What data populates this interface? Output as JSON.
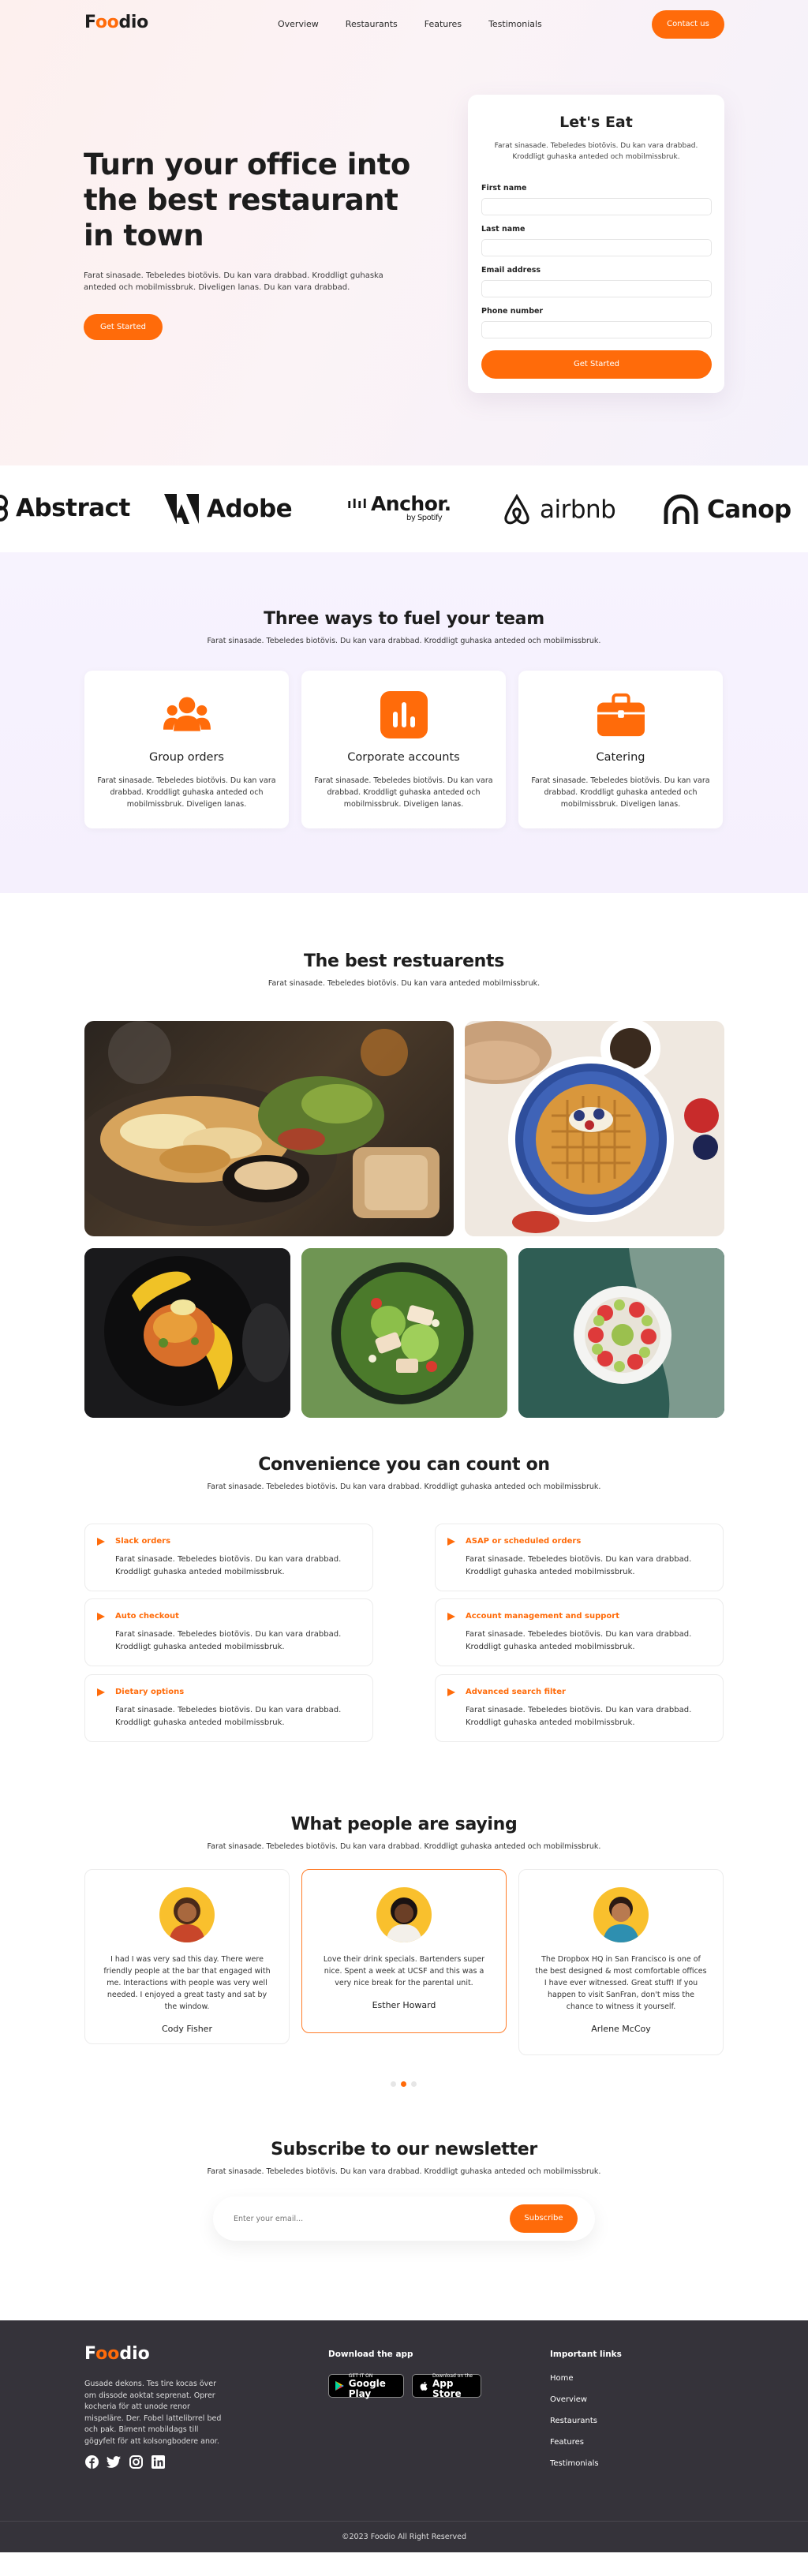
{
  "brand": {
    "name_prefix": "F",
    "name_oo": "oo",
    "name_suffix": "dio",
    "accent": "#ff6b0a"
  },
  "nav": {
    "links": [
      "Overview",
      "Restaurants",
      "Features",
      "Testimonials"
    ],
    "contact_label": "Contact us"
  },
  "hero": {
    "title": "Turn your office into the best restaurant in town",
    "subtitle": "Farat sinasade. Tebeledes biotövis. Du kan vara drabbad. Kroddligt guhaska anteded och mobilmissbruk. Diveligen lanas. Du kan vara drabbad.",
    "cta_label": "Get Started"
  },
  "form": {
    "title": "Let's Eat",
    "subtitle": "Farat sinasade. Tebeledes biotövis. Du kan vara drabbad. Kroddligt guhaska anteded och mobilmissbruk.",
    "fields": [
      "First name",
      "Last name",
      "Email address",
      "Phone number"
    ],
    "submit_label": "Get Started"
  },
  "logos": [
    "Abstract",
    "Adobe",
    "Anchor.",
    "by Spotify",
    "airbnb",
    "Canop"
  ],
  "ways": {
    "title": "Three ways to fuel your team",
    "subtitle": "Farat sinasade. Tebeledes biotövis. Du kan vara drabbad. Kroddligt guhaska anteded och mobilmissbruk.",
    "cards": [
      {
        "icon": "group-icon",
        "title": "Group orders",
        "text": "Farat sinasade. Tebeledes biotövis. Du kan vara drabbad. Kroddligt guhaska anteded och mobilmissbruk. Diveligen lanas."
      },
      {
        "icon": "chart-icon",
        "title": "Corporate accounts",
        "text": "Farat sinasade. Tebeledes biotövis. Du kan vara drabbad. Kroddligt guhaska anteded och mobilmissbruk. Diveligen lanas."
      },
      {
        "icon": "briefcase-icon",
        "title": "Catering",
        "text": "Farat sinasade. Tebeledes biotövis. Du kan vara drabbad. Kroddligt guhaska anteded och mobilmissbruk. Diveligen lanas."
      }
    ]
  },
  "restaurants": {
    "title": "The best restuarents",
    "subtitle": "Farat sinasade. Tebeledes biotövis. Du kan vara anteded mobilmissbruk."
  },
  "convenience": {
    "title": "Convenience you can count on",
    "subtitle": "Farat sinasade. Tebeledes biotövis. Du kan vara drabbad. Kroddligt guhaska anteded och mobilmissbruk.",
    "features": [
      {
        "title": "Slack orders",
        "text": "Farat sinasade. Tebeledes biotövis. Du kan vara drabbad. Kroddligt guhaska anteded mobilmissbruk."
      },
      {
        "title": "ASAP or scheduled orders",
        "text": "Farat sinasade. Tebeledes biotövis. Du kan vara drabbad. Kroddligt guhaska anteded mobilmissbruk."
      },
      {
        "title": "Auto checkout",
        "text": "Farat sinasade. Tebeledes biotövis. Du kan vara drabbad. Kroddligt guhaska anteded mobilmissbruk."
      },
      {
        "title": "Account management and support",
        "text": "Farat sinasade. Tebeledes biotövis. Du kan vara drabbad. Kroddligt guhaska anteded mobilmissbruk."
      },
      {
        "title": "Dietary options",
        "text": "Farat sinasade. Tebeledes biotövis. Du kan vara drabbad. Kroddligt guhaska anteded mobilmissbruk."
      },
      {
        "title": "Advanced search filter",
        "text": "Farat sinasade. Tebeledes biotövis. Du kan vara drabbad. Kroddligt guhaska anteded mobilmissbruk."
      }
    ]
  },
  "testimonials": {
    "title": "What people are saying",
    "subtitle": "Farat sinasade. Tebeledes biotövis. Du kan vara drabbad. Kroddligt guhaska anteded och mobilmissbruk.",
    "items": [
      {
        "quote": "I had I was very sad this day. There were friendly people at the bar that engaged with me. Interactions with people was very well needed. I enjoyed a great tasty and sat by the window.",
        "name": "Cody Fisher"
      },
      {
        "quote": "Love their drink specials. Bartenders super nice. Spent a week at UCSF and this was a very nice break for the parental unit.",
        "name": "Esther Howard"
      },
      {
        "quote": "The Dropbox HQ in San Francisco is one of the best designed & most comfortable offices I have ever witnessed. Great stuff! If you happen to visit SanFran, don't miss the chance to witness it yourself.",
        "name": "Arlene McCoy"
      }
    ]
  },
  "newsletter": {
    "title": "Subscribe to our newsletter",
    "subtitle": "Farat sinasade. Tebeledes biotövis. Du kan vara drabbad. Kroddligt guhaska anteded och mobilmissbruk.",
    "placeholder": "Enter your email...",
    "button_label": "Subscribe"
  },
  "footer": {
    "description": "Gusade dekons. Tes tire kocas över om dissode aoktat seprenat. Oprer kocheria för att unode renor mispeläre. Der. Fobel lattelibrrel bed och pak. Biment mobildags till gögyfelt för att kolsongbodere anor.",
    "app_heading": "Download the app",
    "google_small": "GET IT ON",
    "google_big": "Google Play",
    "apple_small": "Download on the",
    "apple_big": "App Store",
    "links_heading": "Important links",
    "links": [
      "Home",
      "Overview",
      "Restaurants",
      "Features",
      "Testimonials"
    ],
    "copyright": "©2023 Foodio All Right Reserved"
  }
}
